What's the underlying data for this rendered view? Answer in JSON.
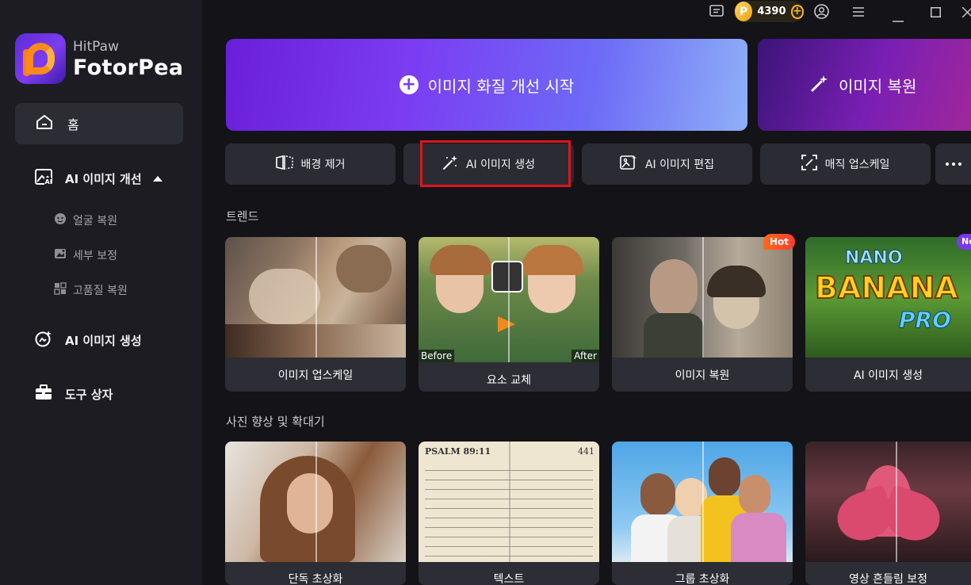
{
  "brand": {
    "small": "HitPaw",
    "big": "FotorPea"
  },
  "topbar": {
    "coins": "4390"
  },
  "sidebar": {
    "home": "홈",
    "ai_enhance": "AI 이미지 개선",
    "sub_items": [
      {
        "label": "얼굴 복원"
      },
      {
        "label": "세부 보정"
      },
      {
        "label": "고품질 복원"
      }
    ],
    "ai_generate": "AI 이미지 생성",
    "toolbox": "도구 상자"
  },
  "hero": {
    "main_label": "이미지 화질 개선 시작",
    "side_label": "이미지 복원"
  },
  "tools": [
    {
      "label": "배경 제거"
    },
    {
      "label": "AI 이미지 생성"
    },
    {
      "label": "AI 이미지 편집"
    },
    {
      "label": "매직 업스케일"
    }
  ],
  "trend": {
    "title": "트렌드",
    "cards": [
      {
        "label": "이미지 업스케일"
      },
      {
        "label": "요소 교체",
        "before": "Before",
        "after": "After"
      },
      {
        "label": "이미지 복원",
        "badge": "Hot"
      },
      {
        "label": "AI 이미지 생성",
        "badge": "New",
        "art_text_1": "NANO",
        "art_text_2": "BANANA",
        "art_text_3": "PRO"
      }
    ]
  },
  "enhance": {
    "title": "사진 향상 및 확대기",
    "cards": [
      {
        "label": "단독 초상화"
      },
      {
        "label": "텍스트",
        "psalm": "PSALM 89:11",
        "page": "441"
      },
      {
        "label": "그룹 초상화"
      },
      {
        "label": "영상 흔들림 보정"
      }
    ]
  },
  "colors": {
    "accent": "#7a3ff0",
    "highlight": "#e0141b",
    "hot": "#ff4a24"
  }
}
